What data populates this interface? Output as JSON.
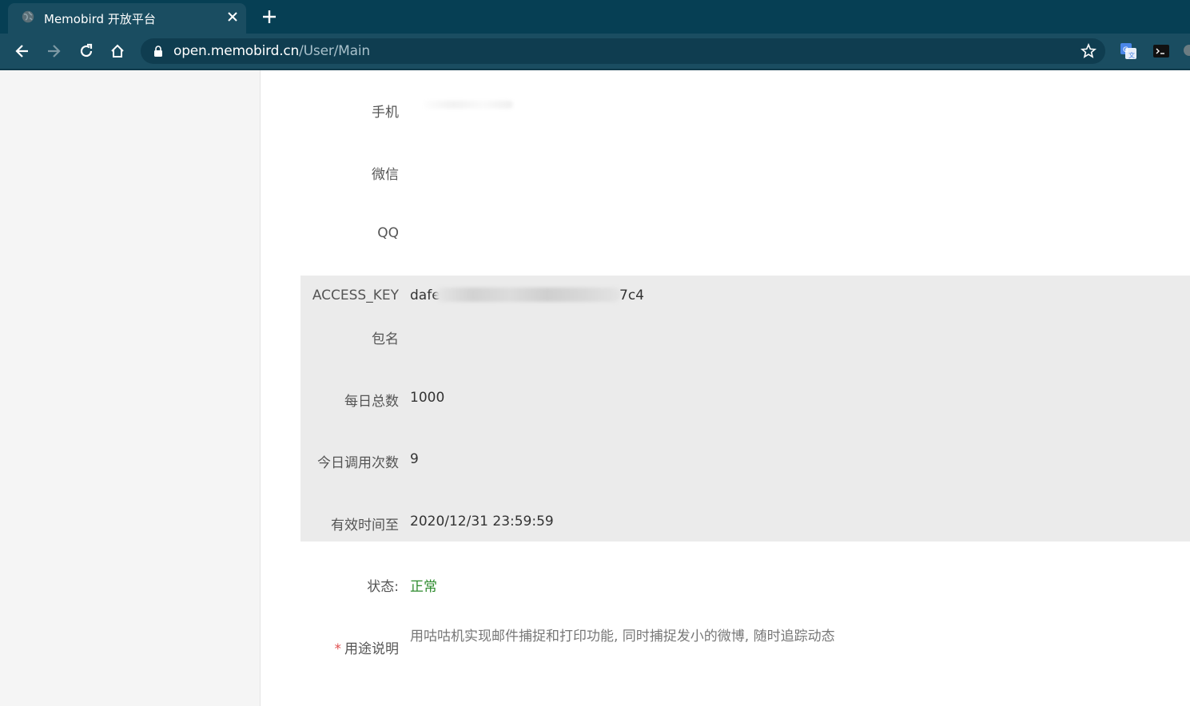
{
  "browser": {
    "tab_title": "Memobird 开放平台",
    "url_host": "open.memobird.cn",
    "url_path": "/User/Main"
  },
  "form": {
    "phone_label": "手机",
    "phone_value": "",
    "wechat_label": "微信",
    "wechat_value": "",
    "qq_label": "QQ",
    "qq_value": "",
    "access_key_label": "ACCESS_KEY",
    "access_key_prefix": "dafe",
    "access_key_suffix": "7c4",
    "package_label": "包名",
    "package_value": "",
    "daily_total_label": "每日总数",
    "daily_total_value": "1000",
    "calls_today_label": "今日调用次数",
    "calls_today_value": "9",
    "valid_until_label": "有效时间至",
    "valid_until_value": "2020/12/31 23:59:59",
    "status_label": "状态:",
    "status_value": "正常",
    "usage_required_mark": "*",
    "usage_label": "用途说明",
    "usage_value": "用咕咕机实现邮件捕捉和打印功能, 同时捕捉发小的微博, 随时追踪动态"
  },
  "colors": {
    "tabbar": "#063f54",
    "toolbar": "#1a4d61",
    "panel_gray": "#ebebeb",
    "status_green": "#2e8b2e",
    "required_red": "#e05050"
  },
  "icons": [
    "globe-icon",
    "close-icon",
    "plus-icon",
    "back-arrow-icon",
    "forward-arrow-icon",
    "reload-icon",
    "home-icon",
    "lock-icon",
    "star-icon",
    "translate-extension-icon",
    "terminal-extension-icon"
  ]
}
